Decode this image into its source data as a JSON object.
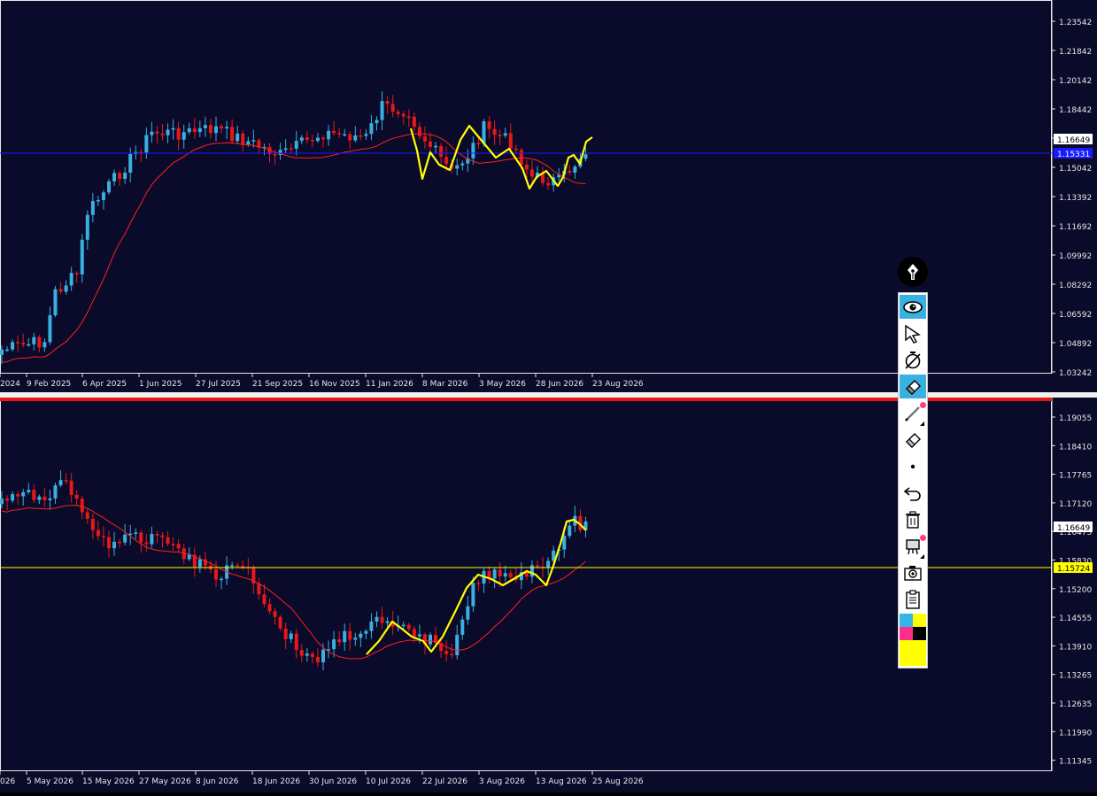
{
  "top_chart": {
    "price_labels": [
      "1.23542",
      "1.21842",
      "1.20142",
      "1.18442",
      "1.16742",
      "1.15042",
      "1.13392",
      "1.11692",
      "1.09992",
      "1.08292",
      "1.06592",
      "1.04892",
      "1.03242"
    ],
    "current_price": "1.16649",
    "line_price": "1.15331",
    "date_labels": [
      "2024",
      "9 Feb 2025",
      "6 Apr 2025",
      "1 Jun 2025",
      "27 Jul 2025",
      "21 Sep 2025",
      "16 Nov 2025",
      "11 Jan 2026",
      "8 Mar 2026",
      "3 May 2026",
      "28 Jun 2026",
      "23 Aug 2026"
    ]
  },
  "bottom_chart": {
    "price_labels": [
      "1.19055",
      "1.18410",
      "1.17765",
      "1.17120",
      "1.16475",
      "1.15830",
      "1.15200",
      "1.14555",
      "1.13910",
      "1.13265",
      "1.12635",
      "1.11990",
      "1.11345"
    ],
    "current_price": "1.16649",
    "line_price": "1.15724",
    "date_labels": [
      "026",
      "5 May 2026",
      "15 May 2026",
      "27 May 2026",
      "8 Jun 2026",
      "18 Jun 2026",
      "30 Jun 2026",
      "10 Jul 2026",
      "22 Jul 2026",
      "3 Aug 2026",
      "13 Aug 2026",
      "25 Aug 2026"
    ]
  },
  "colors": {
    "background": "#0a0a2a",
    "bull": "#3ab0e0",
    "bear": "#e81818",
    "ma": "#ff2020",
    "zigzag": "#ffff00",
    "hline_top": "#1a1aff",
    "hline_bottom": "#ffff00"
  },
  "toolbar": {
    "buttons": [
      "eye-icon",
      "cursor-arrow-icon",
      "crossed-compass-icon",
      "eraser-icon",
      "pen-icon",
      "eraser-outline-icon",
      "dot-icon",
      "undo-icon",
      "trash-icon",
      "clear-all-icon",
      "camera-icon",
      "clipboard-icon"
    ],
    "swatches": [
      "#33b5e5",
      "#ffff00",
      "#ff2d8a",
      "#000000",
      "#ffff00"
    ]
  }
}
